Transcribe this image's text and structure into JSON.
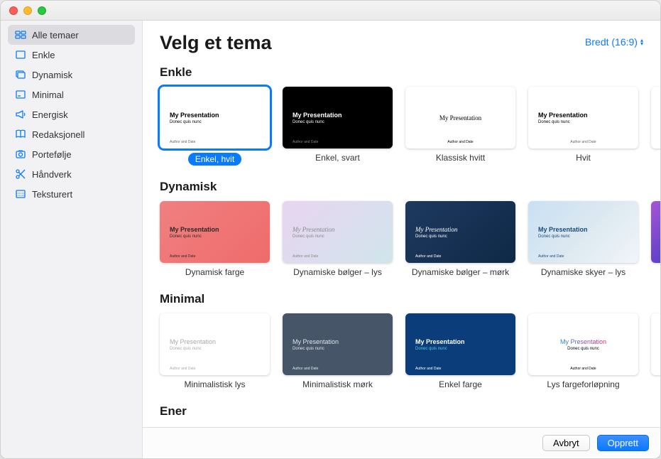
{
  "header": {
    "title": "Velg et tema",
    "aspect_label": "Bredt (16:9)"
  },
  "sidebar": {
    "items": [
      {
        "label": "Alle temaer",
        "icon": "grid-icon",
        "selected": true
      },
      {
        "label": "Enkle",
        "icon": "square-icon",
        "selected": false
      },
      {
        "label": "Dynamisk",
        "icon": "layers-icon",
        "selected": false
      },
      {
        "label": "Minimal",
        "icon": "minimal-icon",
        "selected": false
      },
      {
        "label": "Energisk",
        "icon": "megaphone-icon",
        "selected": false
      },
      {
        "label": "Redaksjonell",
        "icon": "book-icon",
        "selected": false
      },
      {
        "label": "Portefølje",
        "icon": "camera-icon",
        "selected": false
      },
      {
        "label": "Håndverk",
        "icon": "scissors-icon",
        "selected": false
      },
      {
        "label": "Teksturert",
        "icon": "texture-icon",
        "selected": false
      }
    ]
  },
  "thumb_text": {
    "title": "My Presentation",
    "sub": "Donec quis nunc",
    "foot": "Author and Date"
  },
  "sections": [
    {
      "title": "Enkle",
      "templates": [
        {
          "label": "Enkel, hvit",
          "style": "t-white",
          "selected": true,
          "footpos": "left"
        },
        {
          "label": "Enkel, svart",
          "style": "t-black",
          "selected": false,
          "footpos": "left"
        },
        {
          "label": "Klassisk hvitt",
          "style": "t-classic",
          "selected": false,
          "footpos": "center"
        },
        {
          "label": "Hvit",
          "style": "t-white",
          "selected": false,
          "footpos": "center"
        }
      ],
      "partial_style": "t-white"
    },
    {
      "title": "Dynamisk",
      "templates": [
        {
          "label": "Dynamisk farge",
          "style": "t-dyn1",
          "selected": false,
          "footpos": "left"
        },
        {
          "label": "Dynamiske bølger – lys",
          "style": "t-dyn2",
          "selected": false,
          "footpos": "left"
        },
        {
          "label": "Dynamiske bølger – mørk",
          "style": "t-dyn3",
          "selected": false,
          "footpos": "left"
        },
        {
          "label": "Dynamiske skyer – lys",
          "style": "t-dyn4",
          "selected": false,
          "footpos": "left"
        }
      ],
      "partial_style": "t-dyn5"
    },
    {
      "title": "Minimal",
      "templates": [
        {
          "label": "Minimalistisk lys",
          "style": "t-min1",
          "selected": false,
          "footpos": "left"
        },
        {
          "label": "Minimalistisk mørk",
          "style": "t-min2",
          "selected": false,
          "footpos": "left"
        },
        {
          "label": "Enkel farge",
          "style": "t-min3",
          "selected": false,
          "footpos": "left"
        },
        {
          "label": "Lys fargeforløpning",
          "style": "t-min4",
          "selected": false,
          "footpos": "center"
        }
      ],
      "partial_style": "t-white"
    },
    {
      "title": "Ener",
      "templates": [],
      "partial_style": null
    }
  ],
  "footer": {
    "cancel": "Avbryt",
    "create": "Opprett"
  }
}
